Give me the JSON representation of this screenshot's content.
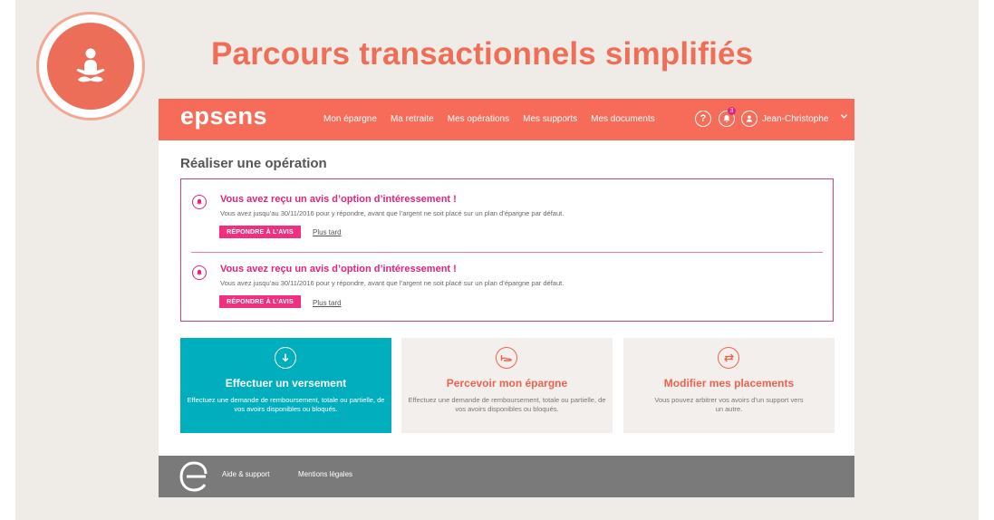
{
  "hero": {
    "title": "Parcours transactionnels simplifiés"
  },
  "header": {
    "brand": "epsens",
    "nav": [
      "Mon épargne",
      "Ma retraite",
      "Mes opérations",
      "Mes supports",
      "Mes documents"
    ],
    "notification_count": "3",
    "user_name": "Jean-Christophe"
  },
  "main": {
    "title": "Réaliser une opération",
    "notices": [
      {
        "title": "Vous avez reçu un avis d’option d’intéressement !",
        "text": "Vous avez jusqu’au 30/11/2016 pour y répondre, avant que l’argent ne soit placé sur un plan d’épargne par défaut.",
        "button": "RÉPONDRE À L’AVIS",
        "later": "Plus tard"
      },
      {
        "title": "Vous avez reçu un avis d’option d’intéressement !",
        "text": "Vous avez jusqu’au 30/11/2016 pour y répondre, avant que l’argent ne soit placé sur un plan d’épargne par défaut.",
        "button": "RÉPONDRE À L’AVIS",
        "later": "Plus tard"
      }
    ],
    "cards": [
      {
        "title": "Effectuer un versement",
        "text": "Effectuez une demande de remboursement, totale ou partielle, de vos avoirs disponibles ou bloqués.",
        "icon": "download-arrow-icon"
      },
      {
        "title": "Percevoir mon épargne",
        "text": "Effectuez une demande de remboursement, totale ou partielle, de vos avoirs disponibles ou bloqués.",
        "icon": "hand-money-icon"
      },
      {
        "title": "Modifier mes placements",
        "text": "Vous pouvez arbitrer vos avoirs d’un support vers un autre.",
        "icon": "swap-arrows-icon"
      }
    ]
  },
  "footer": {
    "links": [
      "Aide & support",
      "Mentions légales"
    ]
  },
  "colors": {
    "brand_coral": "#f76c58",
    "accent_pink": "#e3227e",
    "teal": "#00aebd",
    "footer_grey": "#7a7a7a",
    "slide_bg": "#efece8"
  }
}
